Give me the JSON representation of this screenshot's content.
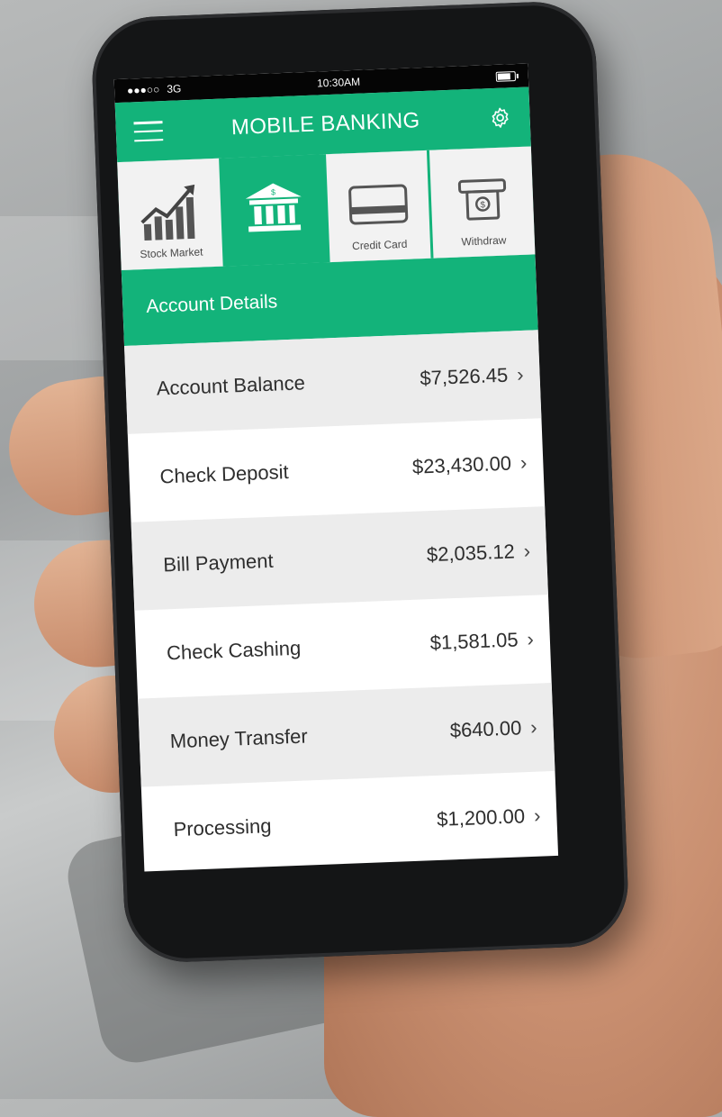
{
  "status_bar": {
    "signal": "●●●○○",
    "network": "3G",
    "time": "10:30AM",
    "battery_level": 0.8
  },
  "header": {
    "title": "MOBILE BANKING",
    "menu_icon": "hamburger-menu-icon",
    "settings_icon": "gear-icon"
  },
  "tabs": [
    {
      "label": "Stock Market",
      "icon": "stock-chart-icon",
      "active": false
    },
    {
      "label": "",
      "icon": "bank-icon",
      "active": true
    },
    {
      "label": "Credit Card",
      "icon": "credit-card-icon",
      "active": false
    },
    {
      "label": "Withdraw",
      "icon": "cash-withdraw-icon",
      "active": false
    }
  ],
  "section": {
    "title": "Account Details"
  },
  "rows": [
    {
      "label": "Account Balance",
      "value": "$7,526.45"
    },
    {
      "label": "Check Deposit",
      "value": "$23,430.00"
    },
    {
      "label": "Bill Payment",
      "value": "$2,035.12"
    },
    {
      "label": "Check Cashing",
      "value": "$1,581.05"
    },
    {
      "label": "Money Transfer",
      "value": "$640.00"
    },
    {
      "label": "Processing",
      "value": "$1,200.00"
    }
  ],
  "chevron": "›",
  "colors": {
    "accent": "#13b37a",
    "row_shade": "#ececec",
    "text": "#2e2e2e"
  }
}
